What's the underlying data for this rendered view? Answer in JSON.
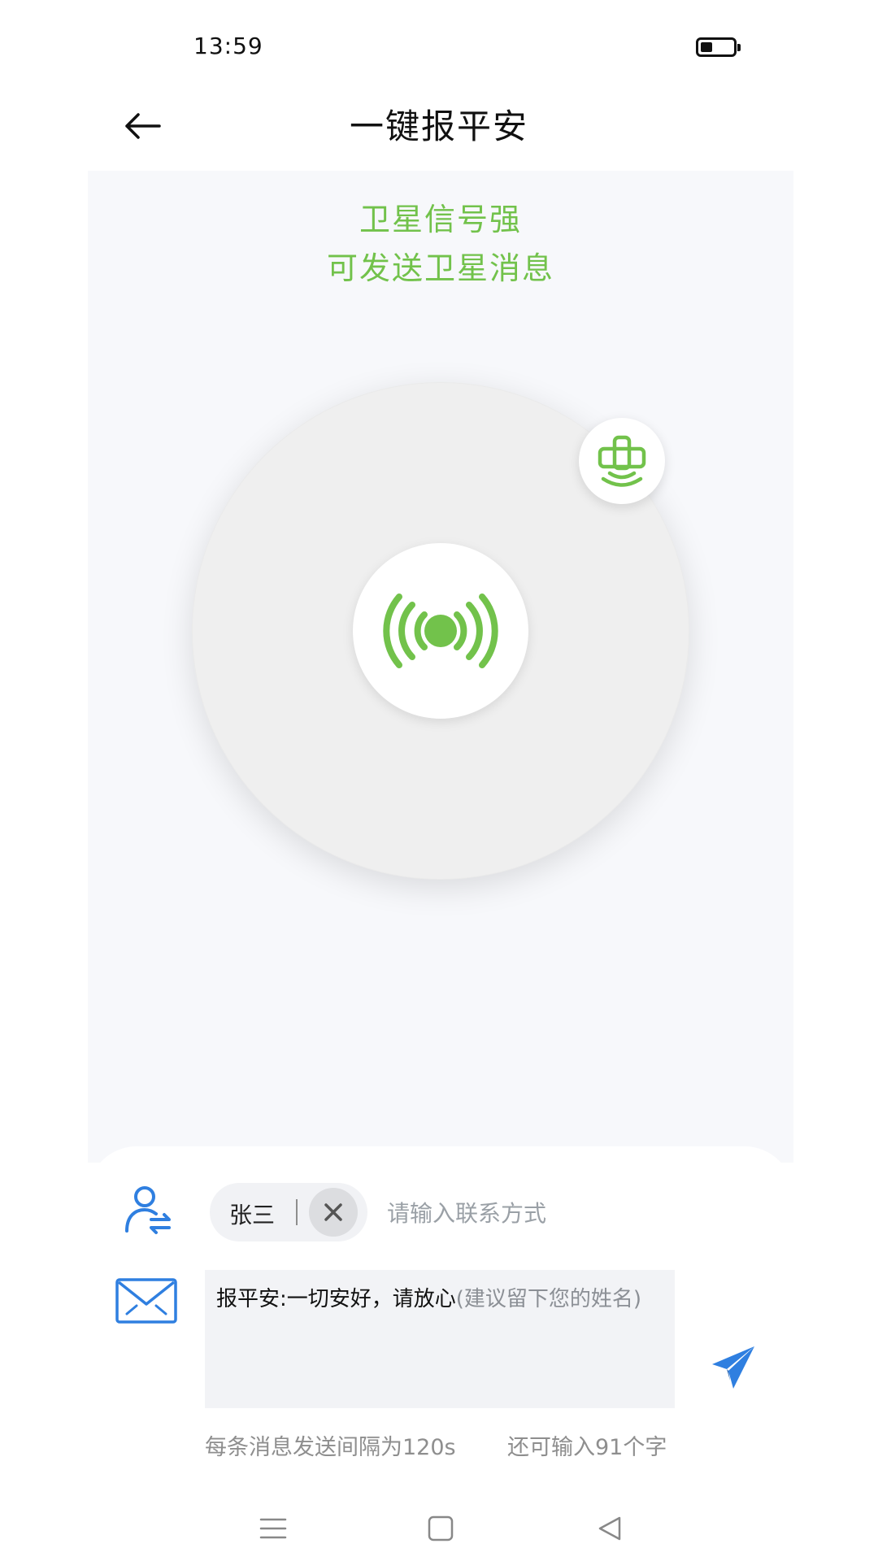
{
  "status_bar": {
    "time": "13:59"
  },
  "header": {
    "title": "一键报平安"
  },
  "signal": {
    "line1": "卫星信号强",
    "line2": "可发送卫星消息"
  },
  "contact": {
    "selected_name": "张三",
    "input_placeholder": "请输入联系方式",
    "input_value": ""
  },
  "message": {
    "text": "报平安:一切安好，请放心",
    "hint": "(建议留下您的姓名)"
  },
  "notes": {
    "interval": "每条消息发送间隔为120s",
    "remaining": "还可输入91个字"
  },
  "colors": {
    "accent_green": "#72c24b",
    "accent_blue": "#2f7fe0"
  },
  "icons": {
    "back": "arrow-left-icon",
    "broadcast": "broadcast-signal-icon",
    "satellite": "satellite-dish-icon",
    "contact": "contact-switch-icon",
    "message": "envelope-icon",
    "send": "paper-plane-icon",
    "nav_menu": "menu-lines-icon",
    "nav_home": "square-home-icon",
    "nav_back": "triangle-back-icon"
  }
}
